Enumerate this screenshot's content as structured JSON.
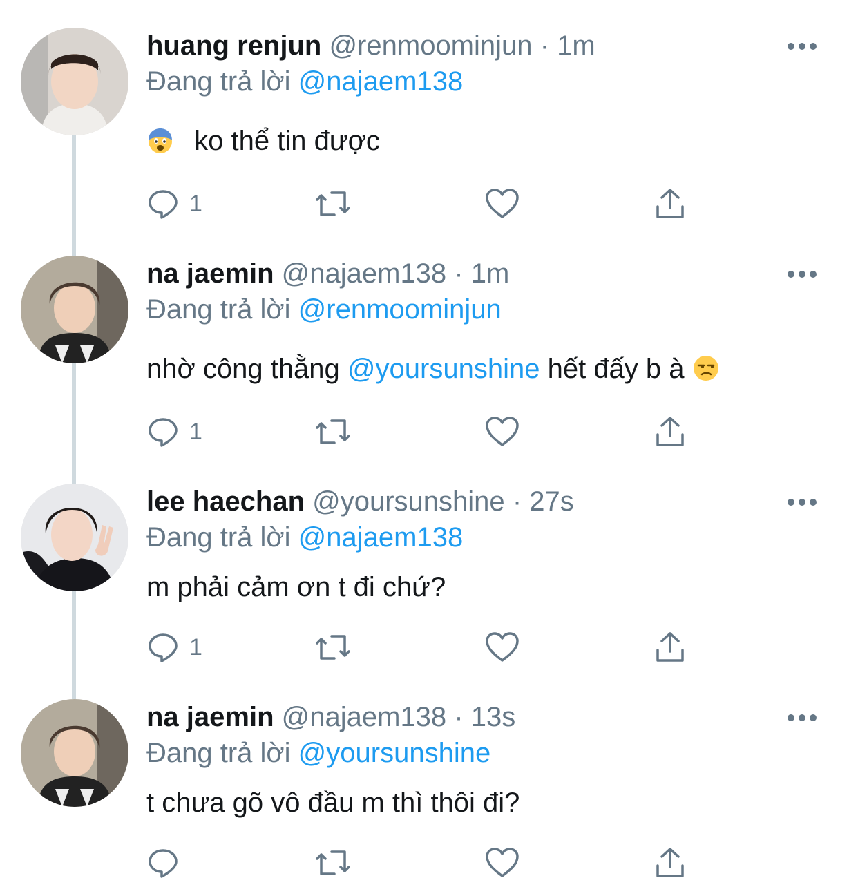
{
  "colors": {
    "text": "#14171a",
    "secondary": "#657786",
    "link": "#1d9bf0",
    "thread_line": "#cfd9de"
  },
  "tweets": [
    {
      "name": "huang renjun",
      "handle": "@renmoominjun",
      "separator": "·",
      "time": "1m",
      "replying_label": "Đang trả lời",
      "replying_to": "@najaem138",
      "body_emoji": "fearful-face-emoji",
      "body_text": "ko thể tin được",
      "reply_count": "1"
    },
    {
      "name": "na jaemin",
      "handle": "@najaem138",
      "separator": "·",
      "time": "1m",
      "replying_label": "Đang trả lời",
      "replying_to": "@renmoominjun",
      "body_before": "nhờ công thằng",
      "body_mention": "@yoursunshine",
      "body_after": "hết đấy b à",
      "body_emoji": "unamused-face-emoji",
      "reply_count": "1"
    },
    {
      "name": "lee haechan",
      "handle": "@yoursunshine",
      "separator": "·",
      "time": "27s",
      "replying_label": "Đang trả lời",
      "replying_to": "@najaem138",
      "body_text": "m phải cảm ơn t đi chứ?",
      "reply_count": "1"
    },
    {
      "name": "na jaemin",
      "handle": "@najaem138",
      "separator": "·",
      "time": "13s",
      "replying_label": "Đang trả lời",
      "replying_to": "@yoursunshine",
      "body_text": "t chưa gõ vô đầu m thì thôi đi?",
      "reply_count": ""
    }
  ],
  "icons": {
    "more": "more-dots-icon",
    "reply": "reply-bubble-icon",
    "retweet": "retweet-icon",
    "like": "heart-icon",
    "share": "share-icon"
  }
}
